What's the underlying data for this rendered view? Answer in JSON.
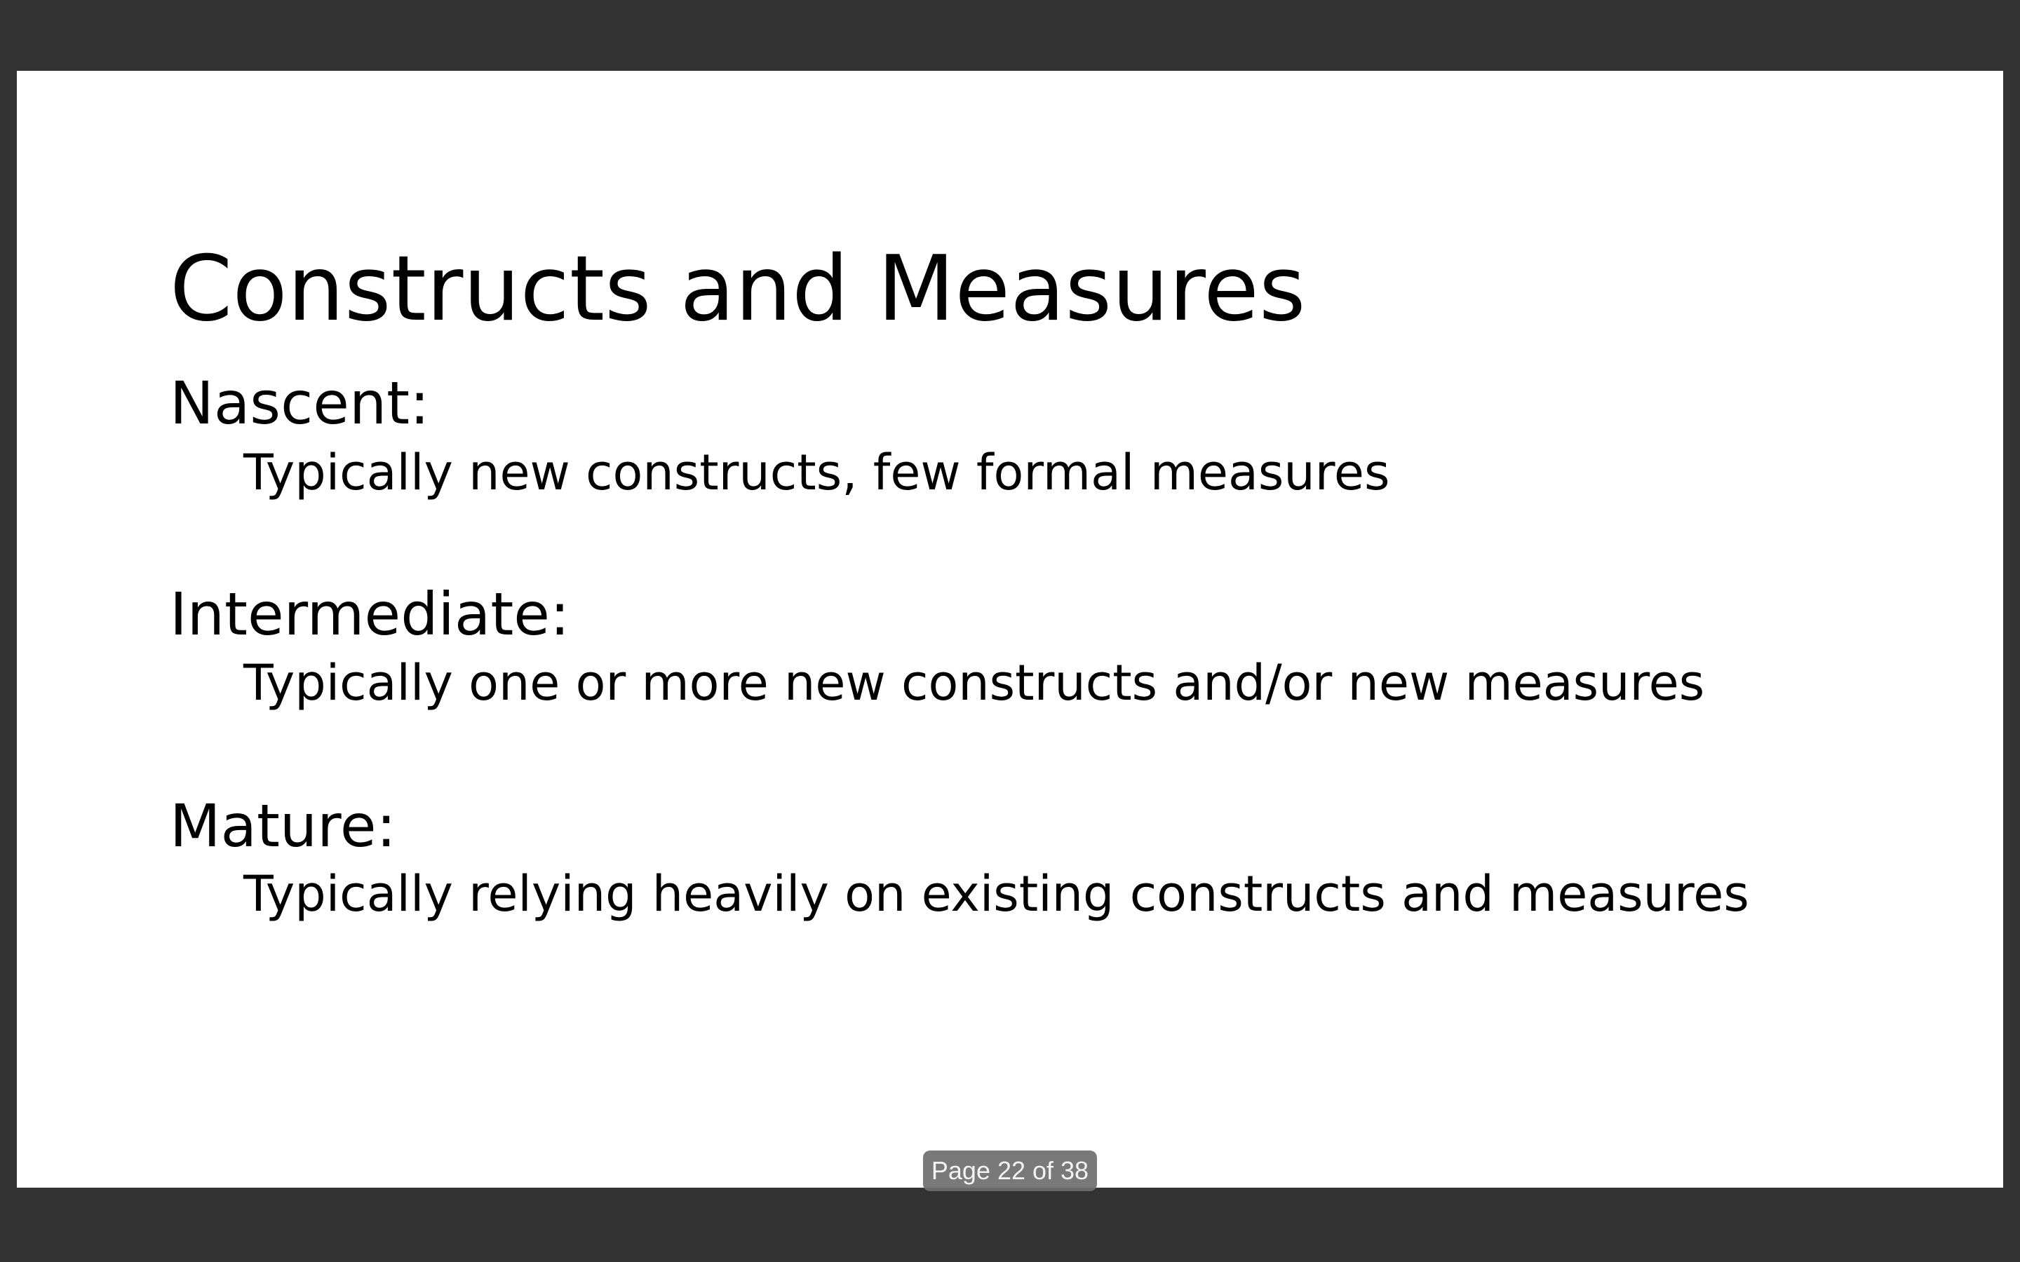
{
  "slide": {
    "title": "Constructs and Measures",
    "sections": [
      {
        "heading": "Nascent:",
        "body": "Typically new constructs, few formal measures"
      },
      {
        "heading": "Intermediate:",
        "body": "Typically one or more new constructs and/or new measures"
      },
      {
        "heading": "Mature:",
        "body": "Typically relying heavily on existing constructs and measures"
      }
    ]
  },
  "viewer": {
    "page_indicator": "Page 22 of 38",
    "background_color": "#333333",
    "slide_color": "#ffffff"
  }
}
